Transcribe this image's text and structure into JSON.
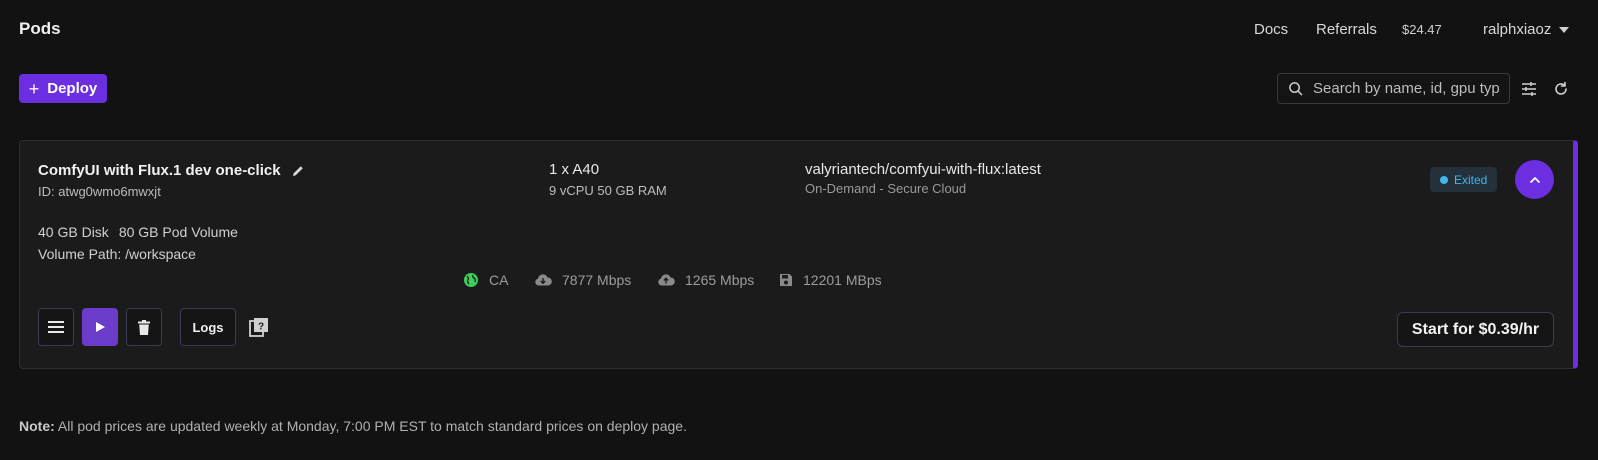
{
  "header": {
    "title": "Pods",
    "nav": {
      "docs": "Docs",
      "referrals": "Referrals"
    },
    "balance": "$24.47",
    "username": "ralphxiaoz"
  },
  "toolbar": {
    "deploy_label": "Deploy",
    "search_placeholder": "Search by name, id, gpu type"
  },
  "pod": {
    "name": "ComfyUI with Flux.1 dev one-click",
    "id": "ID: atwg0wmo6mwxjt",
    "gpu": "1 x A40",
    "cpu_ram": "9 vCPU 50 GB RAM",
    "image": "valyriantech/comfyui-with-flux:latest",
    "cloud": "On-Demand - Secure Cloud",
    "status": "Exited",
    "disk": "40 GB Disk",
    "pod_volume": "80 GB Pod Volume",
    "volume_path": "Volume Path: /workspace",
    "stats": {
      "region": "CA",
      "download": "7877 Mbps",
      "upload": "1265 Mbps",
      "disk_speed": "12201 MBps"
    },
    "logs_label": "Logs",
    "start_label": "Start for $0.39/hr"
  },
  "note": {
    "label": "Note:",
    "text": " All pod prices are updated weekly at Monday, 7:00 PM EST to match standard prices on deploy page."
  },
  "colors": {
    "accent": "#6b2ee0",
    "status": "#3fb6f0",
    "globe": "#3ccf5a"
  }
}
